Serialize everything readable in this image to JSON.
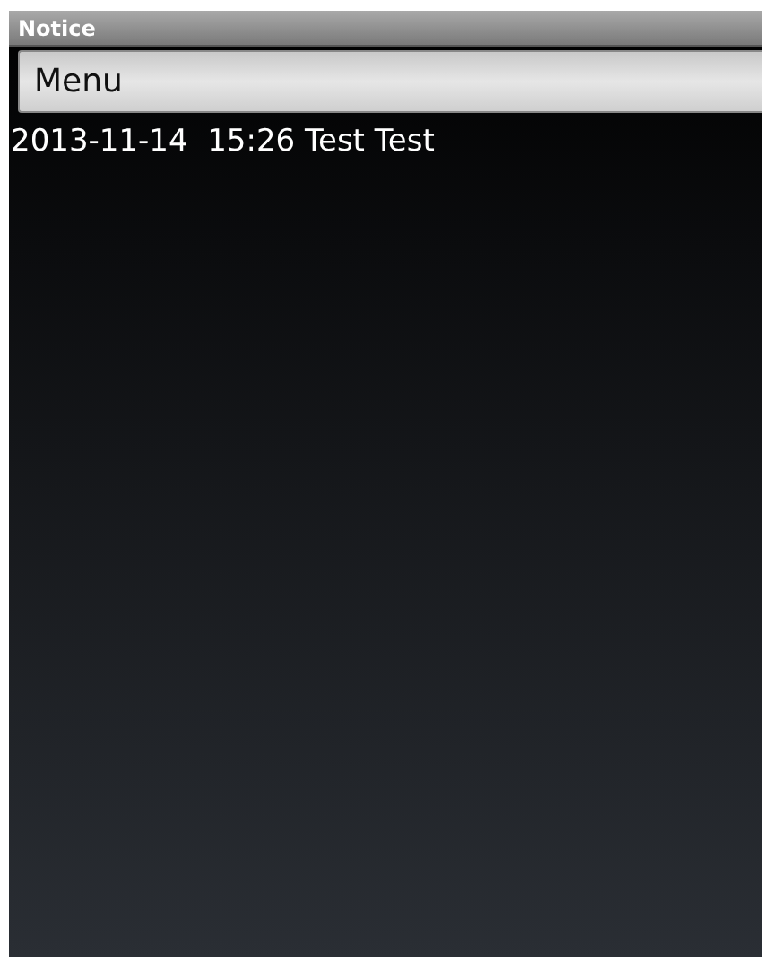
{
  "window": {
    "title": "Notice"
  },
  "menu_button": {
    "label": "Menu"
  },
  "notices": [
    "2013-11-14  15:26 Test Test"
  ]
}
